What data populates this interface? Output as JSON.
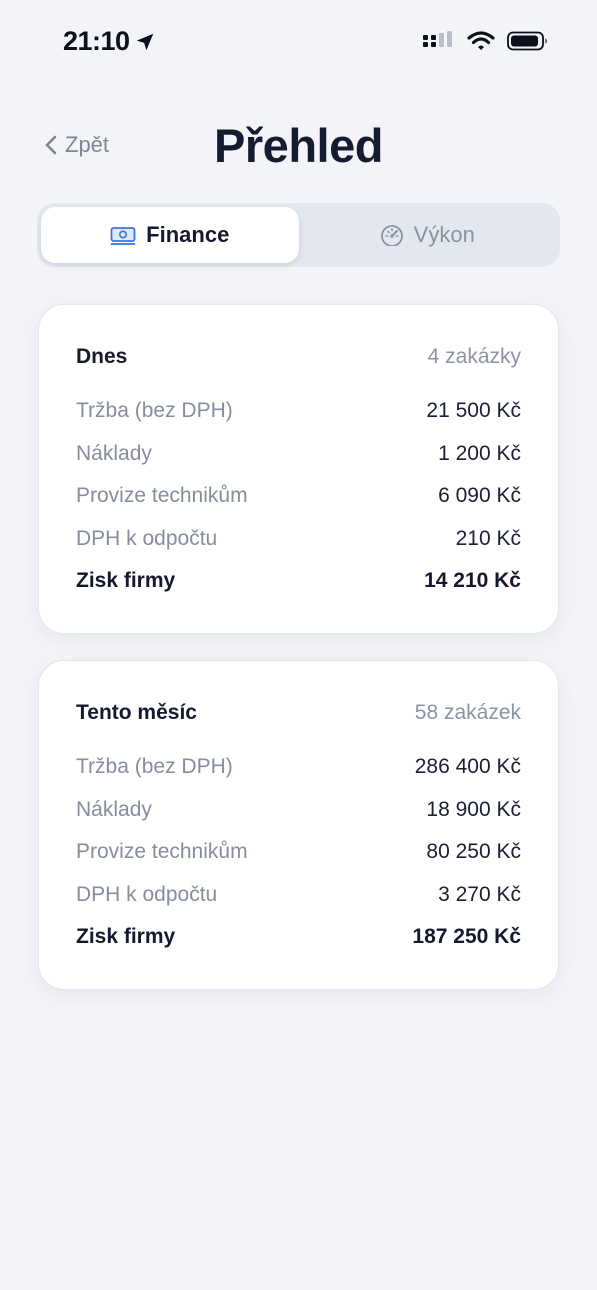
{
  "status_bar": {
    "time": "21:10"
  },
  "nav": {
    "back_label": "Zpět",
    "title": "Přehled"
  },
  "tabs": [
    {
      "label": "Finance",
      "icon": "banknote-icon",
      "active": true
    },
    {
      "label": "Výkon",
      "icon": "gauge-icon",
      "active": false
    }
  ],
  "cards": [
    {
      "title": "Dnes",
      "count": "4 zakázky",
      "rows": [
        {
          "label": "Tržba (bez DPH)",
          "value": "21 500 Kč"
        },
        {
          "label": "Náklady",
          "value": "1 200 Kč"
        },
        {
          "label": "Provize technikům",
          "value": "6 090 Kč"
        },
        {
          "label": "DPH k odpočtu",
          "value": "210 Kč"
        },
        {
          "label": "Zisk firmy",
          "value": "14 210 Kč"
        }
      ]
    },
    {
      "title": "Tento měsíc",
      "count": "58 zakázek",
      "rows": [
        {
          "label": "Tržba (bez DPH)",
          "value": "286 400 Kč"
        },
        {
          "label": "Náklady",
          "value": "18 900 Kč"
        },
        {
          "label": "Provize technikům",
          "value": "80 250 Kč"
        },
        {
          "label": "DPH k odpočtu",
          "value": "3 270 Kč"
        },
        {
          "label": "Zisk firmy",
          "value": "187 250 Kč"
        }
      ]
    }
  ],
  "colors": {
    "background": "#f2f4f8",
    "accent_icon": "#3b73d9",
    "muted_text": "#858d9f",
    "primary_text": "#141a2e"
  }
}
